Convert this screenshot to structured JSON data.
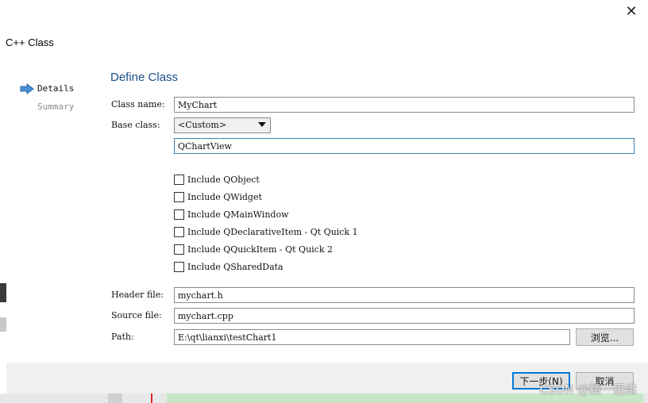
{
  "window": {
    "title": "C++ Class",
    "close_glyph": "✕"
  },
  "steps": [
    {
      "label": "Details",
      "active": true
    },
    {
      "label": "Summary",
      "active": false
    }
  ],
  "page": {
    "title": "Define Class"
  },
  "form": {
    "class_name_label": "Class name:",
    "class_name_value": "MyChart",
    "base_class_label": "Base class:",
    "base_class_selected": "<Custom>",
    "custom_base_value": "QChartView",
    "options": [
      {
        "label": "Include QObject",
        "checked": false
      },
      {
        "label": "Include QWidget",
        "checked": false
      },
      {
        "label": "Include QMainWindow",
        "checked": false
      },
      {
        "label": "Include QDeclarativeItem - Qt Quick 1",
        "checked": false
      },
      {
        "label": "Include QQuickItem - Qt Quick 2",
        "checked": false
      },
      {
        "label": "Include QSharedData",
        "checked": false
      }
    ],
    "header_file_label": "Header file:",
    "header_file_value": "mychart.h",
    "source_file_label": "Source file:",
    "source_file_value": "mychart.cpp",
    "path_label": "Path:",
    "path_value": "E:\\qt\\lianxi\\testChart1",
    "browse_label": "浏览..."
  },
  "footer": {
    "next_label": "下一步(N)",
    "cancel_label": "取消"
  },
  "watermark": "CSDN @精一思维",
  "colors": {
    "title_blue": "#1c4f8c",
    "arrow_blue": "#4a8fd6",
    "focus_border": "#3c7fb1",
    "primary_border": "#0078d7"
  }
}
